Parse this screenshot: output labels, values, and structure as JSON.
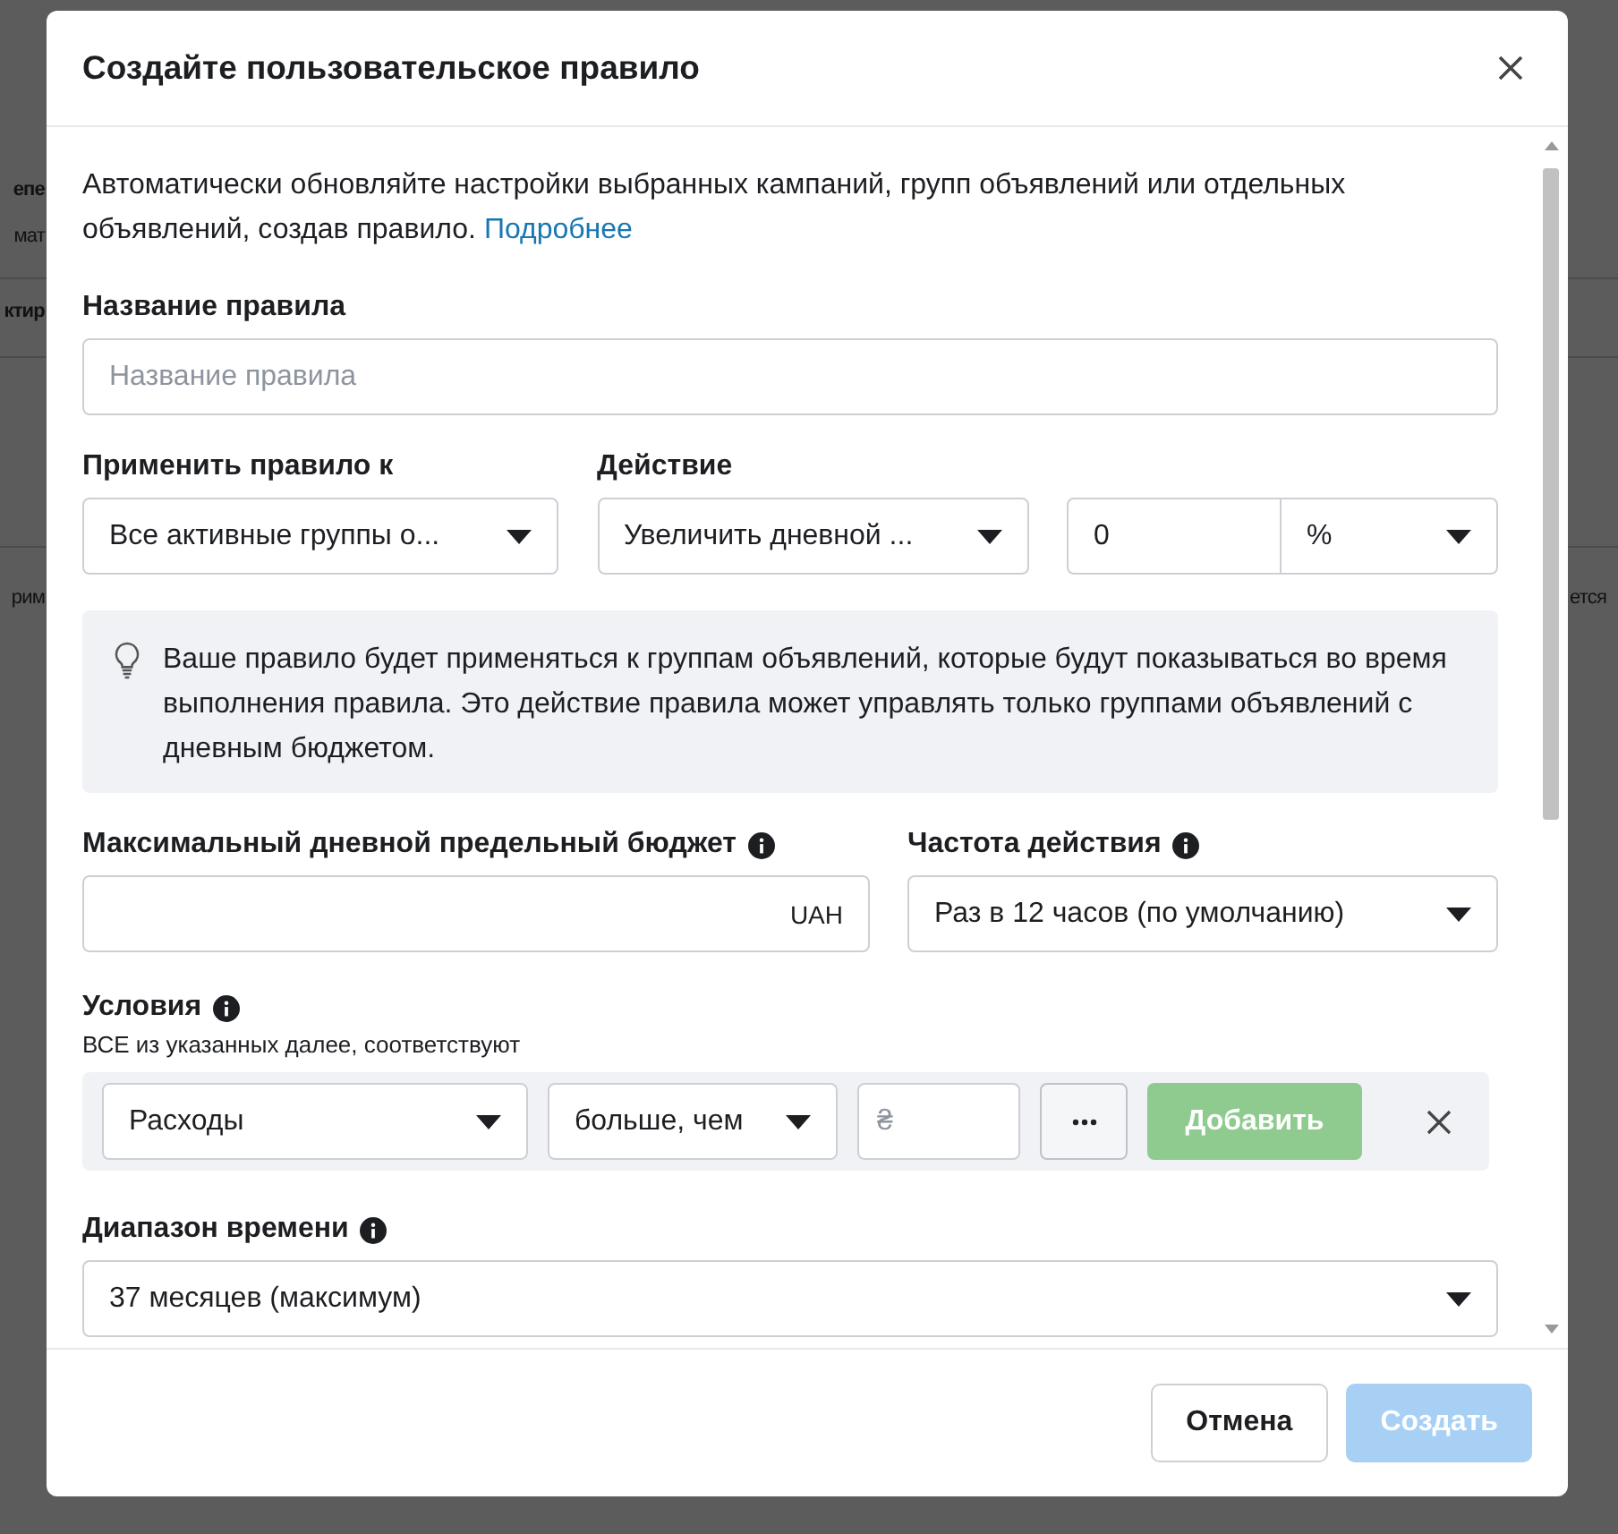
{
  "background": {
    "left_fragments": [
      {
        "text": "епе",
        "bold": true
      },
      {
        "text": "мат",
        "bold": false
      },
      {
        "text": "ктир",
        "bold": true
      },
      {
        "text": "рим",
        "bold": false
      }
    ],
    "right_fragments": [
      {
        "text": "ется",
        "bold": false
      }
    ]
  },
  "dialog": {
    "title": "Создайте пользовательское правило",
    "description": "Автоматически обновляйте настройки выбранных кампаний, групп объявлений или отдельных объявлений, создав правило.",
    "link": "Подробнее",
    "rule_name": {
      "label": "Название правила",
      "placeholder": "Название правила"
    },
    "apply_to": {
      "label": "Применить правило к",
      "value": "Все активные группы о..."
    },
    "action": {
      "label": "Действие",
      "value": "Увеличить дневной ..."
    },
    "amount": {
      "value": "0",
      "unit": "%"
    },
    "notice": "Ваше правило будет применяться к группам объявлений, которые будут показываться во время выполнения правила. Это действие правила может управлять только группами объявлений с дневным бюджетом.",
    "max_budget": {
      "label": "Максимальный дневной предельный бюджет",
      "currency": "UAH"
    },
    "frequency": {
      "label": "Частота действия",
      "value": "Раз в 12 часов (по умолчанию)"
    },
    "conditions": {
      "label": "Условия",
      "subtitle": "ВСЕ из указанных далее, соответствуют",
      "metric": "Расходы",
      "operator": "больше, чем",
      "placeholder": "₴",
      "add_button": {
        "label": "Добавить",
        "disabled": true
      }
    },
    "time_range": {
      "label": "Диапазон времени",
      "value": "37 месяцев (максимум)"
    },
    "buttons": [
      {
        "label": "Отмена",
        "kind": "secondary",
        "disabled": false
      },
      {
        "label": "Создать",
        "kind": "primary",
        "disabled": true
      }
    ]
  }
}
